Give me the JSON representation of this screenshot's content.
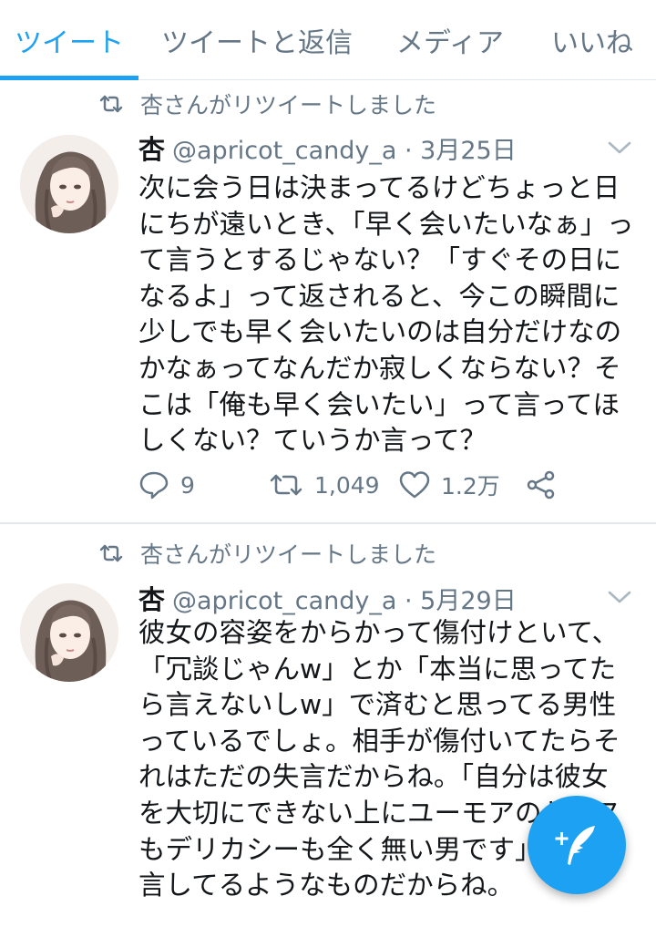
{
  "tabs": [
    {
      "label": "ツイート",
      "active": true
    },
    {
      "label": "ツイートと返信",
      "active": false
    },
    {
      "label": "メディア",
      "active": false
    },
    {
      "label": "いいね",
      "active": false
    }
  ],
  "tweets": [
    {
      "retweet_label": "杏さんがリツイートしました",
      "name": "杏",
      "handle_date": "@apricot_candy_a · 3月25日",
      "text": "次に会う日は決まってるけどちょっと日にちが遠いとき、「早く会いたいなぁ」って言うとするじゃない？「すぐその日になるよ」って返されると、今この瞬間に少しでも早く会いたいのは自分だけなのかなぁってなんだか寂しくならない？そこは「俺も早く会いたい」って言ってほしくない？ていうか言って？",
      "replies": "9",
      "retweets": "1,049",
      "likes": "1.2万"
    },
    {
      "retweet_label": "杏さんがリツイートしました",
      "name": "杏",
      "handle_date": "@apricot_candy_a · 5月29日",
      "text": "彼女の容姿をからかって傷付けといて、「冗談じゃんw」とか「本当に思ってたら言えないしw」で済むと思ってる男性っているでしょ。相手が傷付いてたらそれはただの失言だからね。「自分は彼女を大切にできない上にユーモアのセンスもデリカシーも全く無い男です」って公言してるようなものだからね。"
    }
  ],
  "colors": {
    "accent": "#1da1f2",
    "secondary_text": "#657786",
    "divider": "#e1e8ed"
  },
  "icons": [
    "retweet-icon",
    "chevron-down-icon",
    "reply-icon",
    "heart-icon",
    "share-icon",
    "compose-icon"
  ]
}
